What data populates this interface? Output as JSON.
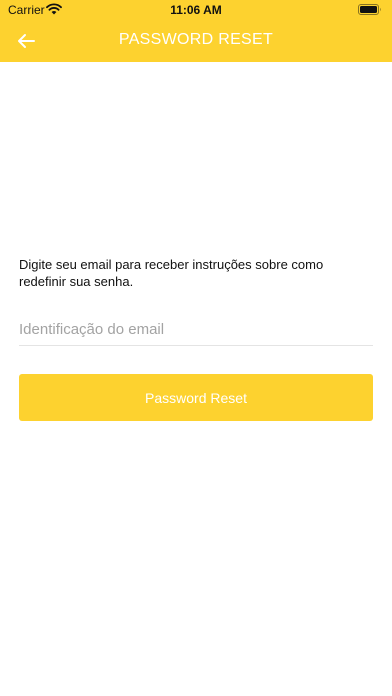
{
  "status_bar": {
    "carrier": "Carrier",
    "time": "11:06 AM",
    "wifi_icon": "wifi-icon",
    "battery_icon": "battery-icon"
  },
  "nav": {
    "back_icon": "arrow-left-icon",
    "title": "PASSWORD RESET"
  },
  "main": {
    "instruction": "Digite seu email para receber instruções sobre como redefinir sua senha.",
    "email_field": {
      "placeholder": "Identificação do email",
      "value": ""
    },
    "reset_button_label": "Password Reset"
  },
  "colors": {
    "brand_yellow": "#fdd22f",
    "text": "#111111",
    "placeholder": "#a3a3a3",
    "divider": "#e4e4e4"
  }
}
